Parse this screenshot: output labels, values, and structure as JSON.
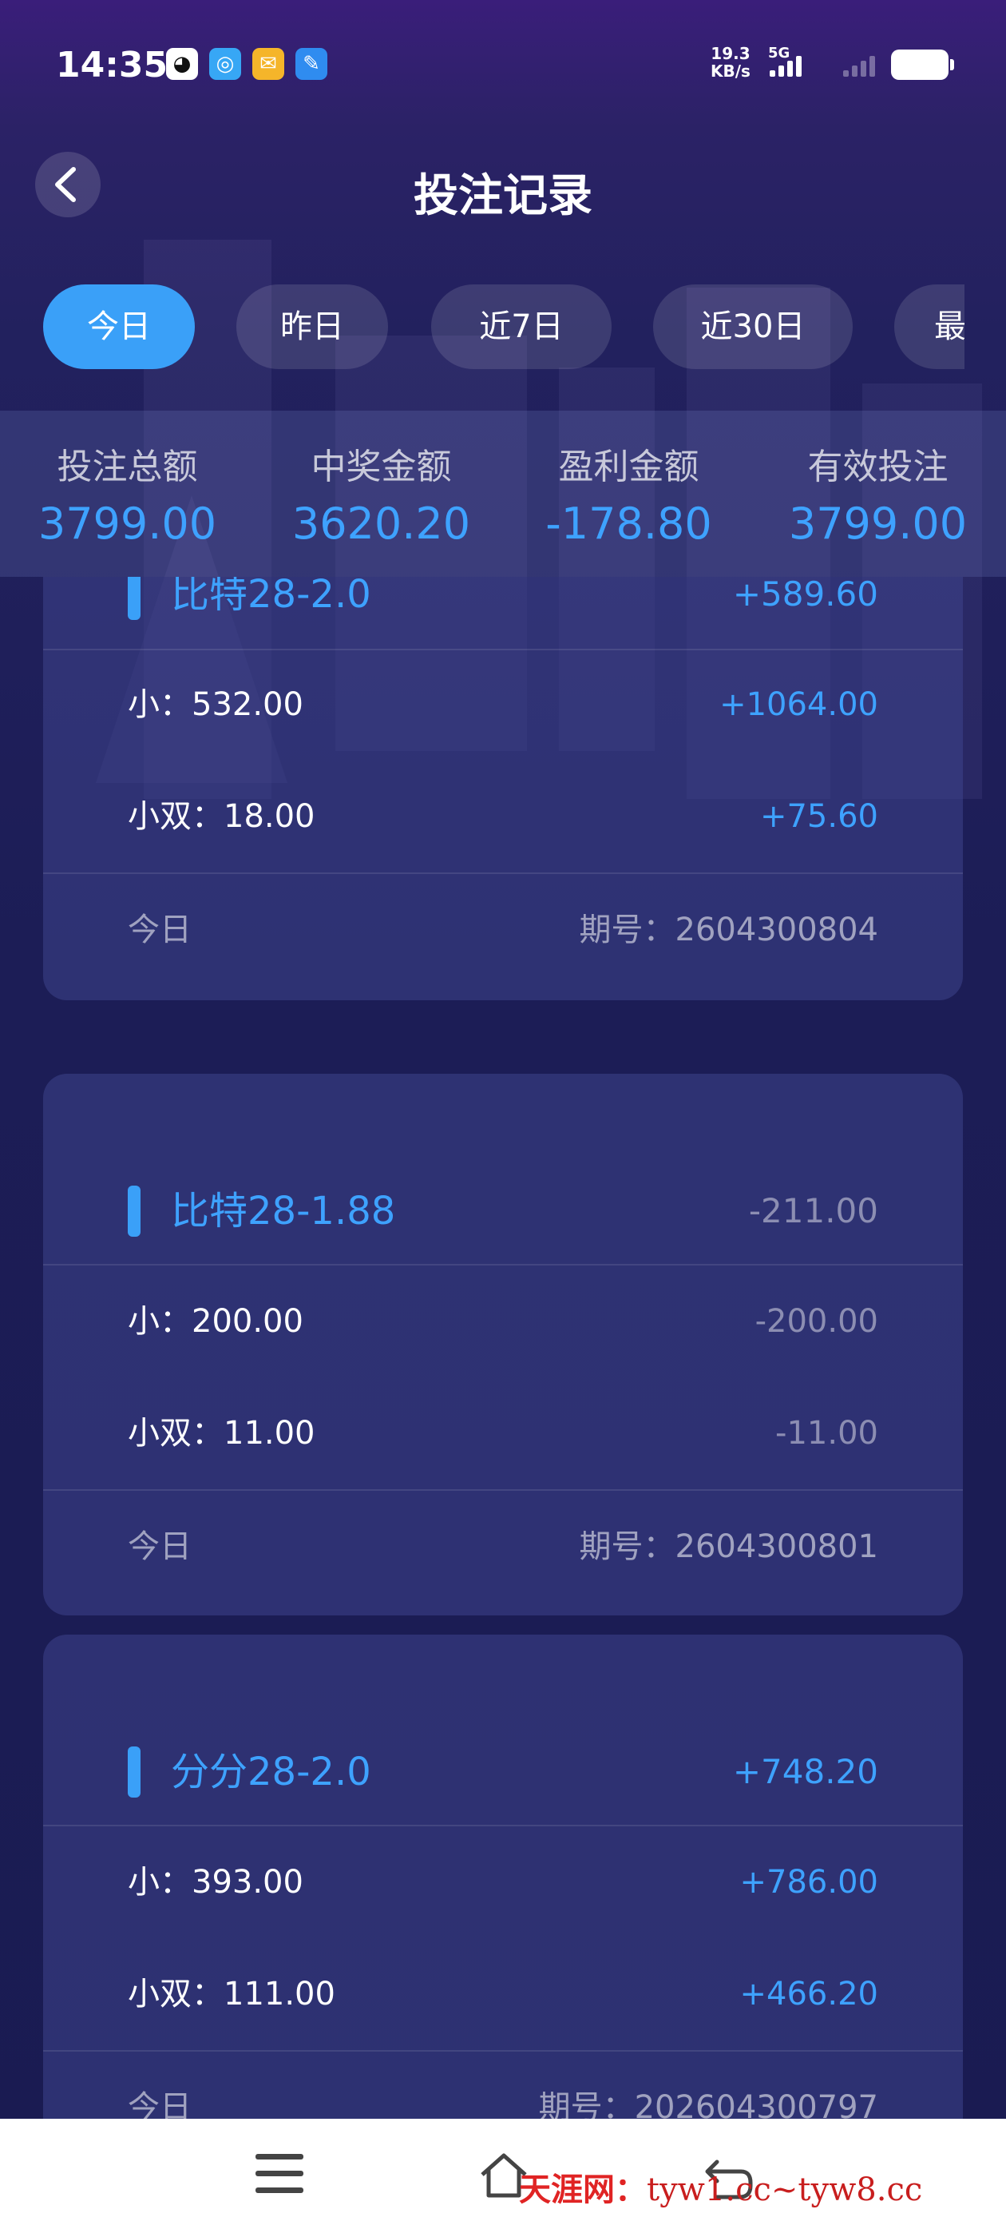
{
  "status_bar": {
    "time": "14:35",
    "net_speed_value": "19.3",
    "net_speed_unit": "KB/s",
    "network_type": "5G",
    "notification_icons": [
      "qq-icon",
      "browser-icon",
      "mail-icon",
      "message-icon"
    ]
  },
  "header": {
    "title": "投注记录",
    "back_icon": "chevron-left-icon"
  },
  "tabs": [
    {
      "label": "今日",
      "active": true
    },
    {
      "label": "昨日",
      "active": false
    },
    {
      "label": "近7日",
      "active": false
    },
    {
      "label": "近30日",
      "active": false
    },
    {
      "label": "最",
      "active": false
    }
  ],
  "summary": [
    {
      "label": "投注总额",
      "value": "3799.00"
    },
    {
      "label": "中奖金额",
      "value": "3620.20"
    },
    {
      "label": "盈利金额",
      "value": "-178.80"
    },
    {
      "label": "有效投注",
      "value": "3799.00"
    }
  ],
  "records": [
    {
      "game": "比特28-2.0",
      "total": "+589.60",
      "bets": [
        {
          "label": "小：532.00",
          "amount": "+1064.00"
        },
        {
          "label": "小双：18.00",
          "amount": "+75.60"
        }
      ],
      "day": "今日",
      "issue": "期号：2604300804"
    },
    {
      "game": "比特28-1.88",
      "total": "-211.00",
      "bets": [
        {
          "label": "小：200.00",
          "amount": "-200.00"
        },
        {
          "label": "小双：11.00",
          "amount": "-11.00"
        }
      ],
      "day": "今日",
      "issue": "期号：2604300801"
    },
    {
      "game": "分分28-2.0",
      "total": "+748.20",
      "bets": [
        {
          "label": "小：393.00",
          "amount": "+786.00"
        },
        {
          "label": "小双：111.00",
          "amount": "+466.20"
        }
      ],
      "day": "今日",
      "issue": "期号：202604300797"
    }
  ],
  "watermark": {
    "brand": "天涯网",
    "separator": "：",
    "domains": "tyw1.cc~tyw8.cc"
  },
  "colors": {
    "accent": "#3aa0f8",
    "value_blue": "#3ea2ff",
    "background": "#1c1d56"
  }
}
